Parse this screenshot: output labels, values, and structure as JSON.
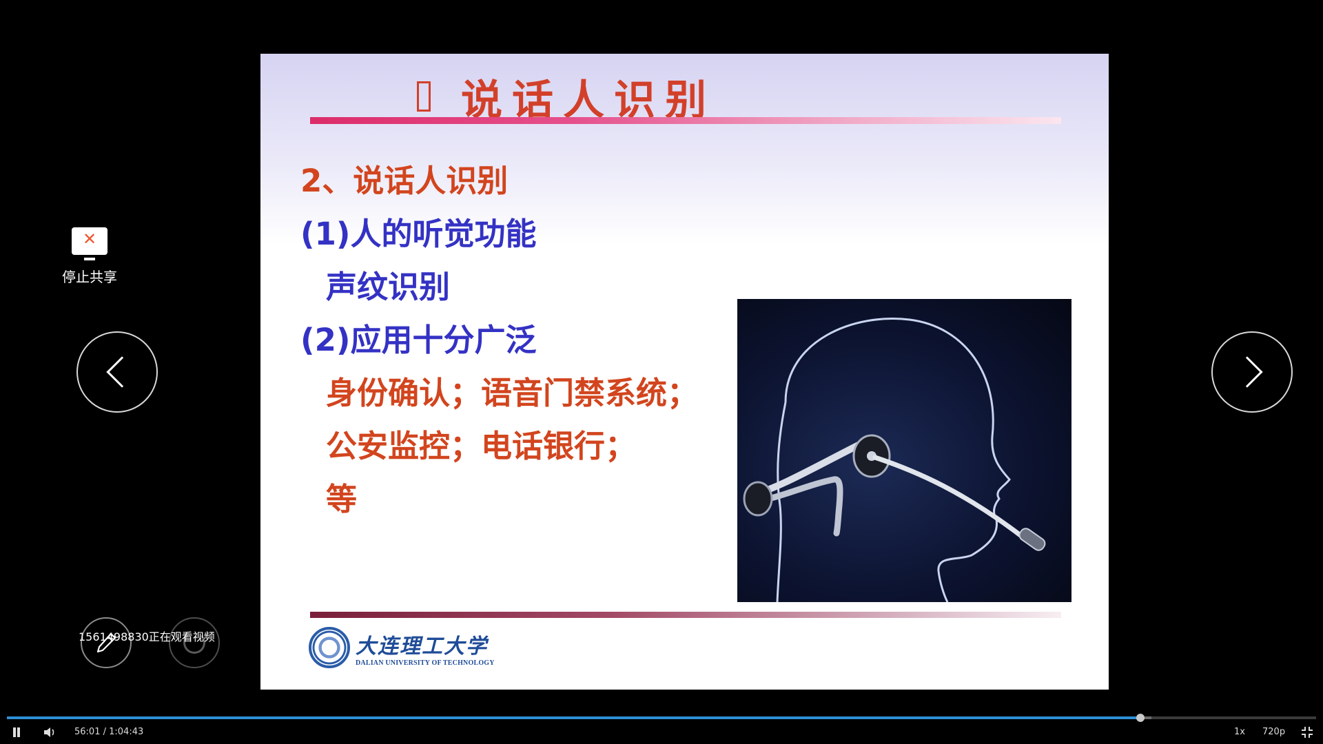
{
  "slide": {
    "title": "说话人识别",
    "lines": [
      {
        "text": "2、说话人识别",
        "color": "red"
      },
      {
        "text": "(1)人的听觉功能",
        "color": "blue"
      },
      {
        "text": "声纹识别",
        "color": "blue"
      },
      {
        "text": "(2)应用十分广泛",
        "color": "blue"
      },
      {
        "text": "身份确认；语音门禁系统；",
        "color": "red"
      },
      {
        "text": "公安监控；电话银行；",
        "color": "red"
      },
      {
        "text": "等",
        "color": "red"
      }
    ],
    "logo": {
      "name_cn": "大连理工大学",
      "name_en": "DALIAN UNIVERSITY OF TECHNOLOGY"
    }
  },
  "overlay": {
    "stop_share_label": "停止共享",
    "viewer_note": "1561498830正在观看视频"
  },
  "player": {
    "current_time": "56:01",
    "separator": " / ",
    "duration": "1:04:43",
    "speed": "1x",
    "quality": "720p",
    "progress_fraction": 0.866,
    "buffer_fraction": 0.874
  },
  "colors": {
    "accent_red": "#d2451e",
    "accent_blue": "#3432c4",
    "progress": "#2e8fd6"
  }
}
